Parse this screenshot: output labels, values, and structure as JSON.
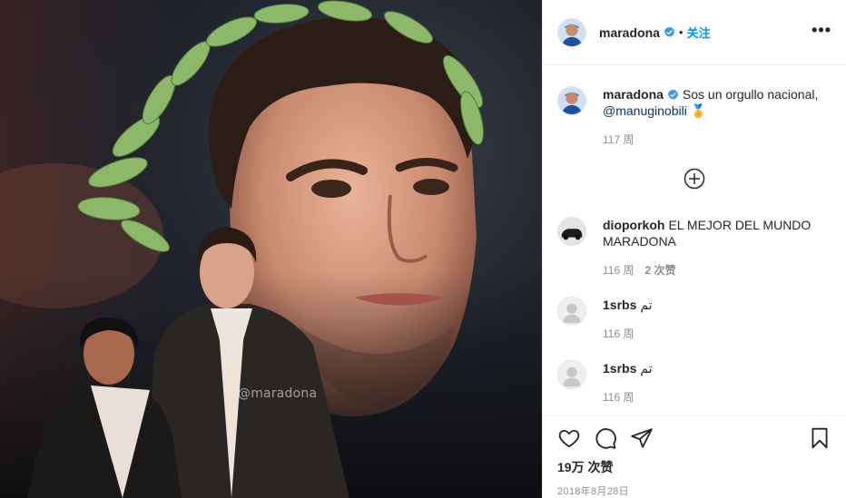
{
  "post": {
    "image": {
      "watermark": "@maradona"
    },
    "header": {
      "username": "maradona",
      "separator": "•",
      "follow_label": "关注",
      "more_label": "•••"
    },
    "caption": {
      "username": "maradona",
      "text": "Sos un orgullo nacional,",
      "mention": "@manuginobili",
      "emoji": "🏅",
      "age": "117 周"
    },
    "comments": [
      {
        "username": "dioporkoh",
        "text": "EL MEJOR DEL MUNDO MARADONA",
        "age": "116 周",
        "likes": "2 次赞"
      },
      {
        "username": "1srbs",
        "text": "تم",
        "age": "116 周"
      },
      {
        "username": "1srbs",
        "text": "تم",
        "age": "116 周"
      }
    ],
    "likes": "19万 次赞",
    "date": "2018年8月28日"
  },
  "colors": {
    "accent": "#0095f6",
    "verified": "#3897f0",
    "muted": "#8e8e8e",
    "text": "#262626"
  },
  "icons": [
    "load-more-plus-icon",
    "heart-icon",
    "comment-icon",
    "share-icon",
    "bookmark-icon",
    "verified-badge-icon"
  ]
}
